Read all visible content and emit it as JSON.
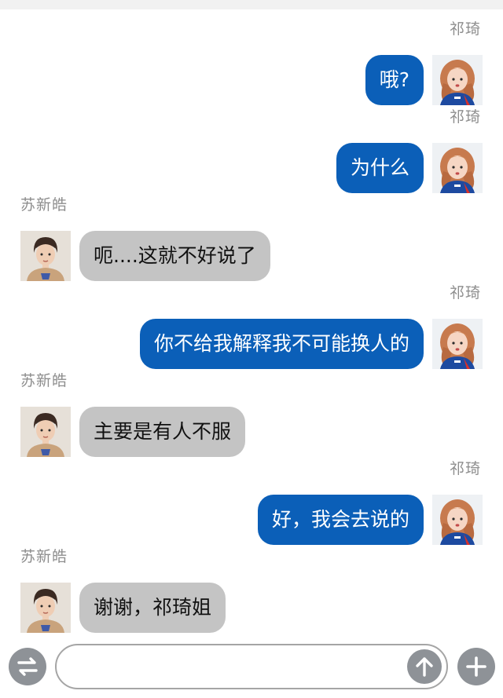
{
  "messages": [
    {
      "side": "right",
      "sender": "祁琦",
      "text": "哦?"
    },
    {
      "side": "right",
      "sender": "祁琦",
      "text": "为什么"
    },
    {
      "side": "left",
      "sender": "苏新皓",
      "text": "呃....这就不好说了"
    },
    {
      "side": "right",
      "sender": "祁琦",
      "text": "你不给我解释我不可能换人的"
    },
    {
      "side": "left",
      "sender": "苏新皓",
      "text": "主要是有人不服"
    },
    {
      "side": "right",
      "sender": "祁琦",
      "text": "好，我会去说的"
    },
    {
      "side": "left",
      "sender": "苏新皓",
      "text": "谢谢，祁琦姐"
    }
  ],
  "input_bar": {
    "text_value": "",
    "icons": [
      "swap-icon",
      "send-arrow-icon",
      "plus-icon"
    ]
  },
  "colors": {
    "outgoing_bubble": "#0b5fb8",
    "incoming_bubble": "#c4c4c4",
    "sender_name": "#8d8d8d",
    "button_gray": "#8e9297"
  }
}
